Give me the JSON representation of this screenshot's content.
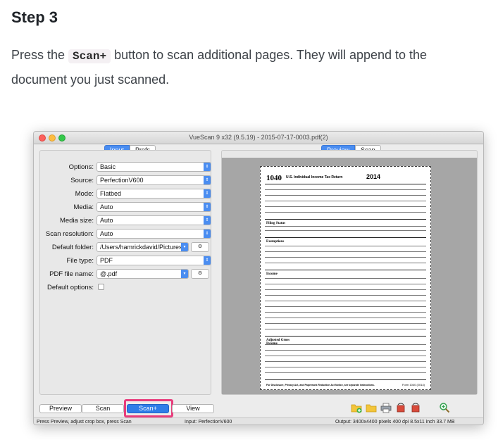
{
  "doc": {
    "step_title": "Step 3",
    "para_before": "Press the ",
    "code": "Scan+",
    "para_after": " button to scan additional pages. They will append to the document you just scanned."
  },
  "window": {
    "title": "VueScan 9 x32 (9.5.19) - 2015-07-17-0003.pdf(2)",
    "left_tabs": [
      "Input",
      "Prefs"
    ],
    "right_tabs": [
      "Preview",
      "Scan"
    ],
    "options": [
      {
        "label": "Options:",
        "value": "Basic"
      },
      {
        "label": "Source:",
        "value": "PerfectionV600"
      },
      {
        "label": "Mode:",
        "value": "Flatbed"
      },
      {
        "label": "Media:",
        "value": "Auto"
      },
      {
        "label": "Media size:",
        "value": "Auto"
      },
      {
        "label": "Scan resolution:",
        "value": "Auto"
      },
      {
        "label": "Default folder:",
        "value": "/Users/hamrickdavid/Pictures"
      },
      {
        "label": "File type:",
        "value": "PDF"
      },
      {
        "label": "PDF file name:",
        "value": "@.pdf"
      },
      {
        "label": "Default options:",
        "value": ""
      }
    ],
    "buttons": {
      "preview": "Preview",
      "scan": "Scan",
      "scan_plus": "Scan+",
      "view": "View"
    },
    "status": {
      "left": "Press Preview, adjust crop box, press Scan",
      "middle": "Input: PerfectionV600",
      "right": "Output: 3400x4400 pixels 400 dpi 8.5x11 inch 33.7 MB"
    },
    "form": {
      "number": "1040",
      "subtitle": "U.S. Individual Income Tax Return",
      "year": "2014",
      "sections": [
        "Filing Status",
        "Exemptions",
        "Income",
        "Adjusted Gross Income"
      ],
      "footer": "For Disclosure, Privacy Act, and Paperwork Reduction Act Notice, see separate instructions.",
      "form_label": "Form 1040 (2014)"
    },
    "colors": {
      "accent": "#4a8df1",
      "highlight": "#e83c7b"
    }
  }
}
